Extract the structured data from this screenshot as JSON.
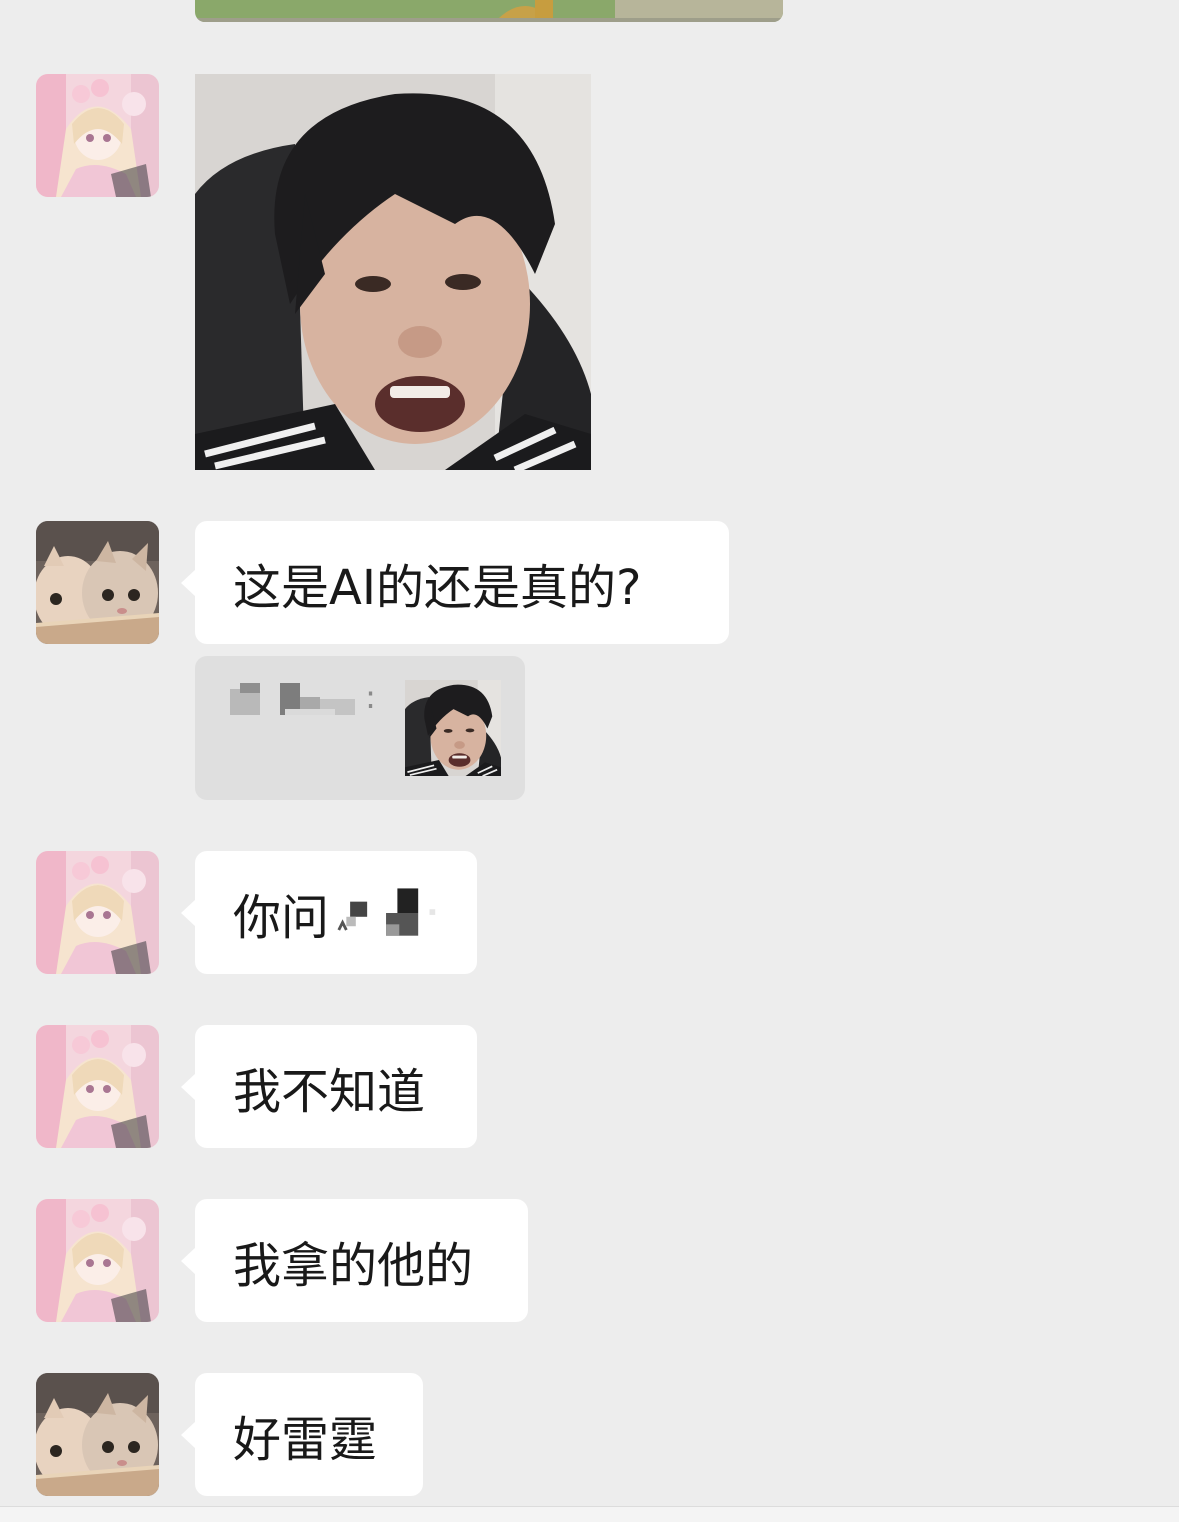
{
  "chat": {
    "messages": [
      {
        "sender": "anime-girl",
        "type": "image-sticker",
        "subject": "teen-grimace-meme"
      },
      {
        "sender": "kittens",
        "type": "text",
        "text": "这是AI的还是真的?"
      },
      {
        "sender": "kittens",
        "type": "quote",
        "quoted_name": "[redacted]",
        "separator": ":",
        "quoted_content": "image-thumbnail"
      },
      {
        "sender": "anime-girl",
        "type": "text",
        "text": "你问",
        "redacted": true
      },
      {
        "sender": "anime-girl",
        "type": "text",
        "text": "我不知道"
      },
      {
        "sender": "anime-girl",
        "type": "text",
        "text": "我拿的他的"
      },
      {
        "sender": "kittens",
        "type": "text",
        "text": "好雷霆"
      }
    ]
  },
  "colors": {
    "background": "#ededed",
    "bubble": "#ffffff",
    "quote_card": "#dfdfdf",
    "text": "#191919"
  },
  "icons": {
    "avatar_a": "anime-girl-avatar-icon",
    "avatar_b": "kittens-avatar-icon"
  }
}
